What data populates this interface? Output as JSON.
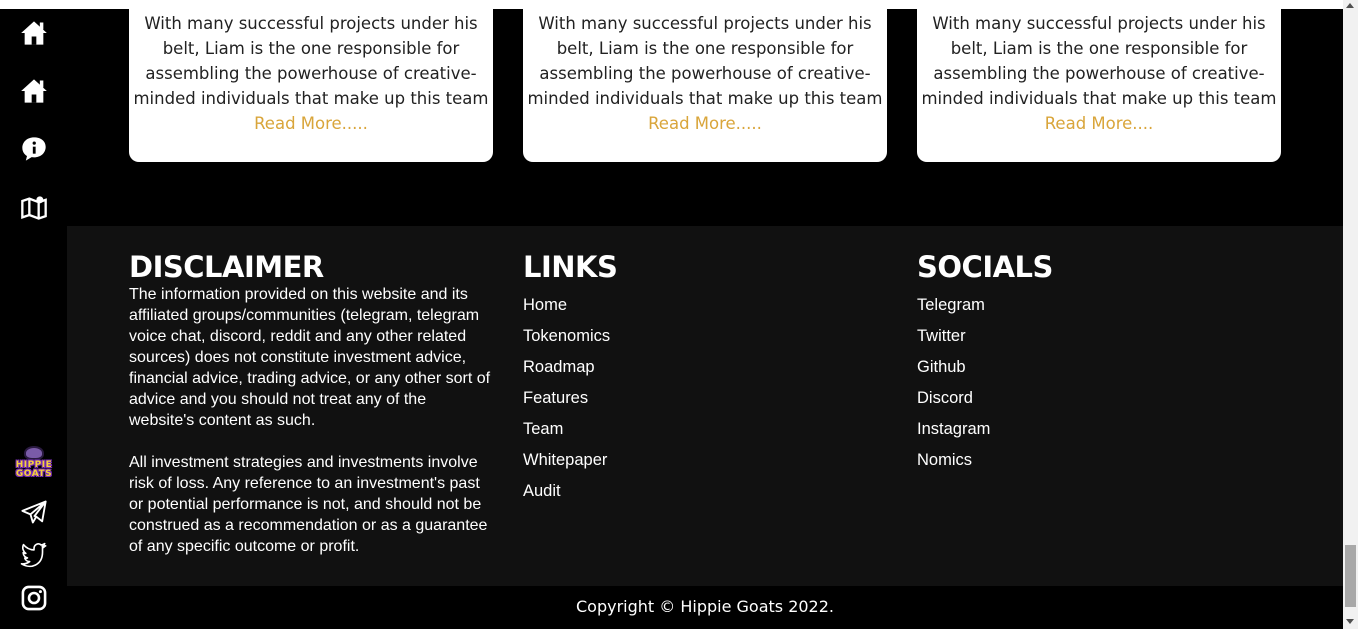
{
  "cards": [
    {
      "text": "With many successful projects under his belt, Liam is the one responsible for assembling the powerhouse of creative-minded individuals that make up this team ",
      "read_more": "Read More....."
    },
    {
      "text": "With many successful projects under his belt, Liam is the one responsible for assembling the powerhouse of creative-minded individuals that make up this team ",
      "read_more": "Read More....."
    },
    {
      "text": "With many successful projects under his belt, Liam is the one responsible for assembling the powerhouse of creative-minded individuals that make up this team ",
      "read_more": "Read More...."
    }
  ],
  "sidebar": {
    "icons": [
      "home-icon",
      "home-icon",
      "info-icon",
      "map-icon"
    ],
    "logo_text": [
      "HIPPIE",
      "GOATS"
    ],
    "social_icons": [
      "telegram-icon",
      "twitter-icon",
      "instagram-icon"
    ]
  },
  "footer": {
    "disclaimer": {
      "title": "DISCLAIMER",
      "paragraph1": "The information provided on this website and its affiliated groups/communities (telegram, telegram voice chat, discord, reddit and any other related sources) does not constitute investment advice, financial advice, trading advice, or any other sort of advice and you should not treat any of the website's content as such.",
      "paragraph2": "All investment strategies and investments involve risk of loss. Any reference to an investment's past or potential performance is not, and should not be construed as a recommendation or as a guarantee of any specific outcome or profit."
    },
    "links": {
      "title": "LINKS",
      "items": [
        "Home",
        "Tokenomics",
        "Roadmap",
        "Features",
        "Team",
        "Whitepaper",
        "Audit"
      ]
    },
    "socials": {
      "title": "SOCIALS",
      "items": [
        "Telegram",
        "Twitter",
        "Github",
        "Discord",
        "Instagram",
        "Nomics"
      ]
    }
  },
  "copyright": "Copyright © Hippie Goats 2022.",
  "colors": {
    "accent": "#d9a53a",
    "footer_bg": "#111111",
    "page_bg": "#000000",
    "card_bg": "#ffffff"
  }
}
